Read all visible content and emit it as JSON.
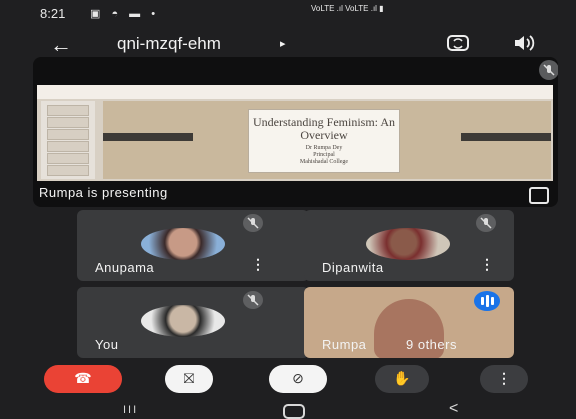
{
  "status_bar": {
    "time": "8:21",
    "icons": "▣ ◓ ▬ •",
    "network": "VoLTE .ıl VoLTE .ıl ▮"
  },
  "top_bar": {
    "back_icon": "←",
    "meeting_code": "qni-mzqf-ehm",
    "caret": "▸"
  },
  "presentation": {
    "slide_title": "Understanding Feminism: An Overview",
    "slide_presenter": "Dr Rumpa Dey",
    "slide_role": "Principal",
    "slide_college": "Mahishadal College",
    "status": "Rumpa is presenting"
  },
  "participants": [
    {
      "name": "Anupama"
    },
    {
      "name": "Dipanwita"
    },
    {
      "name": "You"
    },
    {
      "name": "Rumpa",
      "extra": "9 others"
    }
  ],
  "more_glyph": "⋮",
  "controls": {
    "hangup_icon": "☎",
    "camera_off_icon": "⛝",
    "mic_off_icon": "⊘",
    "hand_icon": "✋",
    "more_icon": "⋮"
  },
  "nav": {
    "recent": "III",
    "back": "<"
  },
  "colors": {
    "hangup": "#ea4335",
    "speaking": "#1a73e8"
  }
}
